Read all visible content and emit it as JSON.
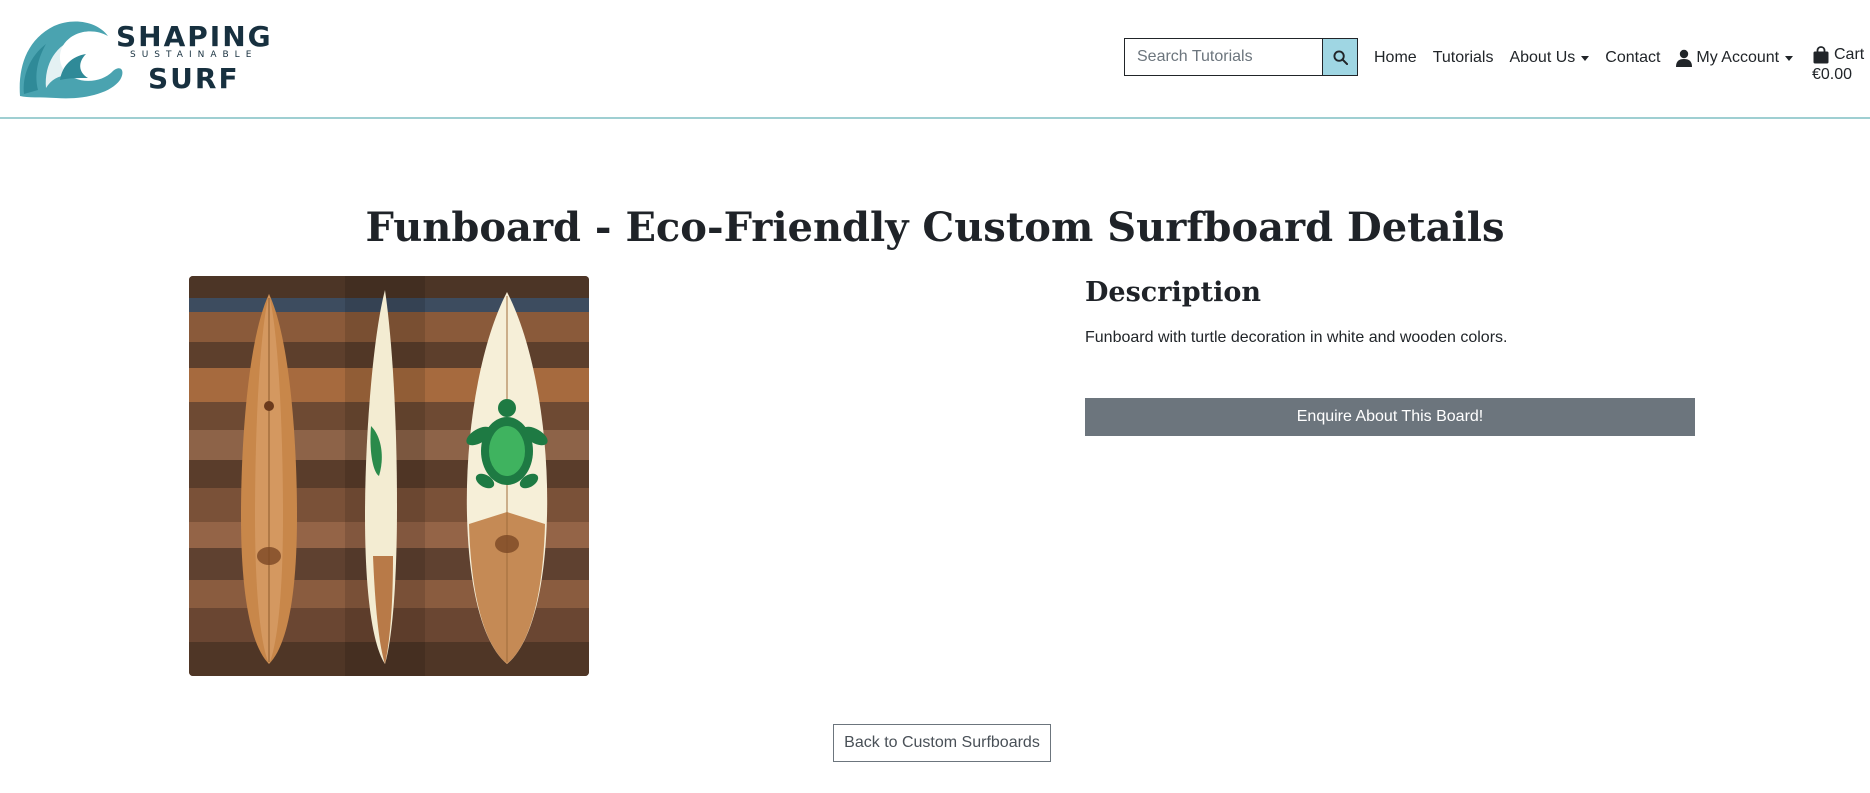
{
  "logo": {
    "line1": "SHAPING",
    "line2": "SUSTAINABLE",
    "line3": "SURF"
  },
  "search": {
    "placeholder": "Search Tutorials"
  },
  "nav": {
    "home": "Home",
    "tutorials": "Tutorials",
    "about": "About Us",
    "contact": "Contact",
    "account": "My Account",
    "cart_label": "Cart",
    "cart_total": "€0.00"
  },
  "main": {
    "title": "Funboard - Eco-Friendly Custom Surfboard Details",
    "description_heading": "Description",
    "description_text": "Funboard with turtle decoration in white and wooden colors.",
    "enquire_button": "Enquire About This Board!",
    "back_button": "Back to Custom Surfboards"
  },
  "colors": {
    "brand_dark": "#17303f",
    "brand_teal": "#4aa3b0",
    "search_button": "#9fd6e3",
    "enquire_button": "#6c757d",
    "header_border": "#9fcfd2"
  }
}
